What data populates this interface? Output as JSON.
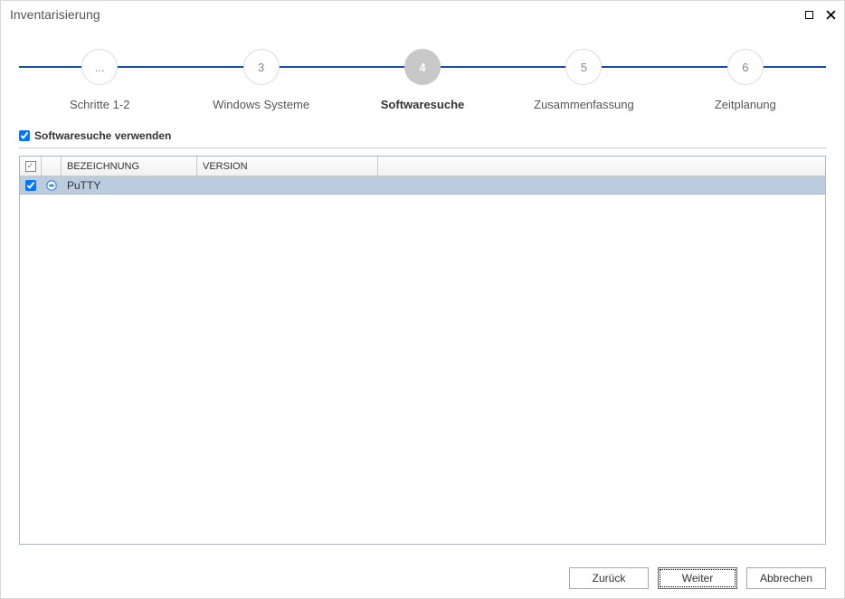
{
  "window": {
    "title": "Inventarisierung"
  },
  "stepper": {
    "steps": [
      {
        "num": "...",
        "label": "Schritte 1-2",
        "active": false
      },
      {
        "num": "3",
        "label": "Windows Systeme",
        "active": false
      },
      {
        "num": "4",
        "label": "Softwaresuche",
        "active": true
      },
      {
        "num": "5",
        "label": "Zusammenfassung",
        "active": false
      },
      {
        "num": "6",
        "label": "Zeitplanung",
        "active": false
      }
    ]
  },
  "use_softwaresearch": {
    "label": "Softwaresuche verwenden",
    "checked": true
  },
  "table": {
    "headers": {
      "bezeichnung": "BEZEICHNUNG",
      "version": "VERSION"
    },
    "header_checked": true,
    "rows": [
      {
        "checked": true,
        "icon": "app-icon",
        "name": "PuTTY",
        "version": ""
      }
    ]
  },
  "buttons": {
    "back": "Zurück",
    "next": "Weiter",
    "cancel": "Abbrechen"
  }
}
